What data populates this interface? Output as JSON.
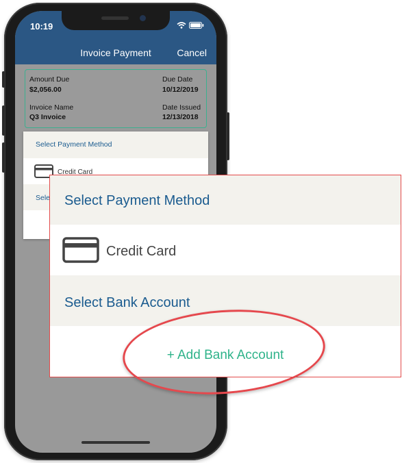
{
  "status_bar": {
    "time": "10:19"
  },
  "header": {
    "title": "Invoice Payment",
    "cancel_label": "Cancel"
  },
  "invoice": {
    "amount_due_label": "Amount Due",
    "amount_due_value": "$2,056.00",
    "due_date_label": "Due Date",
    "due_date_value": "10/12/2019",
    "invoice_name_label": "Invoice Name",
    "invoice_name_value": "Q3 Invoice",
    "date_issued_label": "Date Issued",
    "date_issued_value": "12/13/2018"
  },
  "payment": {
    "select_method_label": "Select Payment Method",
    "credit_card_label": "Credit Card",
    "select_bank_partial": "Selec",
    "select_bank_label": "Select Bank Account",
    "add_bank_label": "+ Add Bank Account"
  },
  "colors": {
    "header_bg": "#2b5784",
    "accent_blue": "#1a5b8f",
    "accent_green": "#2fb38a",
    "highlight_red": "#e5484d",
    "summary_border": "#3bb08f"
  },
  "icons": [
    "wifi-icon",
    "battery-icon",
    "credit-card-icon"
  ]
}
